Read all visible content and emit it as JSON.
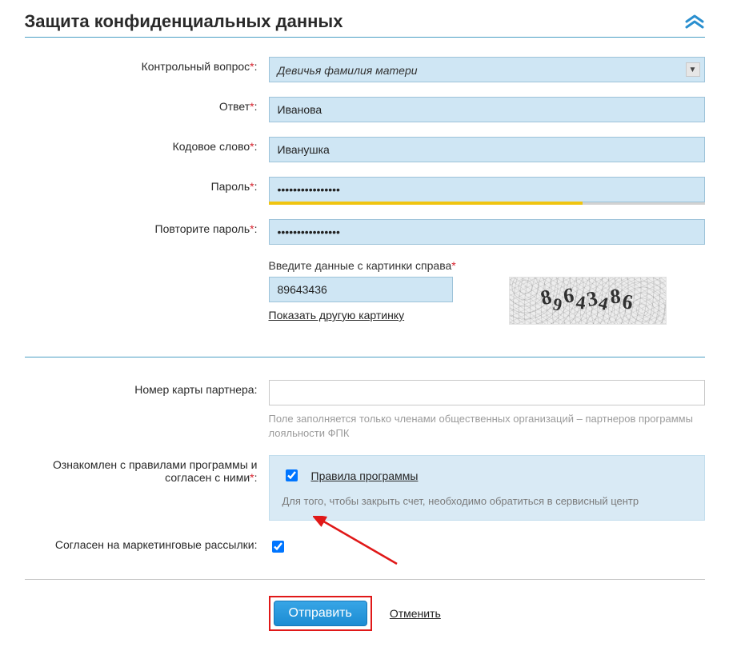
{
  "section": {
    "title": "Защита конфиденциальных данных"
  },
  "labels": {
    "question": "Контрольный вопрос",
    "answer": "Ответ",
    "codeword": "Кодовое слово",
    "password": "Пароль",
    "password_repeat": "Повторите пароль",
    "captcha": "Введите данные с картинки справа",
    "partner_card": "Номер карты партнера:",
    "consent": "Ознакомлен с правилами программы и согласен с ними",
    "marketing": "Согласен на маркетинговые рассылки:"
  },
  "values": {
    "question_selected": "Девичья фамилия матери",
    "answer": "Иванова",
    "codeword": "Иванушка",
    "password": "••••••••••••••••",
    "password_repeat": "••••••••••••••••",
    "captcha_input": "89643436",
    "captcha_digits": [
      "8",
      "9",
      "6",
      "4",
      "3",
      "4",
      "8",
      "6"
    ],
    "partner_card": "",
    "consent_checked": true,
    "marketing_checked": true,
    "password_strength_pct": "72%"
  },
  "links": {
    "captcha_refresh": "Показать другую картинку",
    "rules": "Правила программы",
    "cancel": "Отменить"
  },
  "hints": {
    "partner_card": "Поле заполняется только членами общественных организаций – партнеров программы лояльности ФПК",
    "consent_note": "Для того, чтобы закрыть счет, необходимо обратиться в сервисный центр"
  },
  "actions": {
    "submit": "Отправить"
  }
}
